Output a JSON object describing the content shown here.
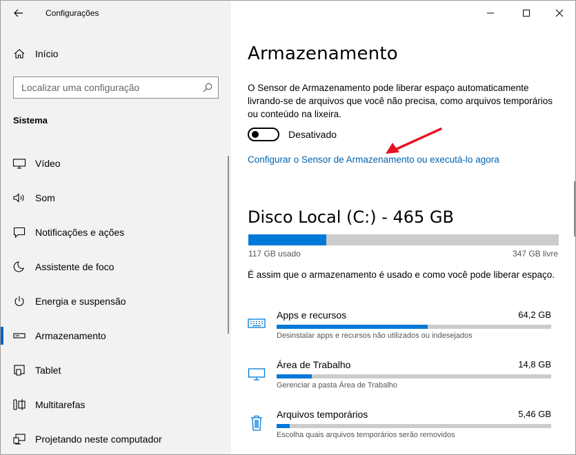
{
  "window": {
    "title": "Configurações",
    "minimize_icon": "minimize-icon",
    "maximize_icon": "maximize-icon",
    "close_icon": "close-icon"
  },
  "sidebar": {
    "home_label": "Início",
    "search_placeholder": "Localizar uma configuração",
    "section_title": "Sistema",
    "items": [
      {
        "label": "Vídeo",
        "icon": "monitor-icon"
      },
      {
        "label": "Som",
        "icon": "speaker-icon"
      },
      {
        "label": "Notificações e ações",
        "icon": "notification-icon"
      },
      {
        "label": "Assistente de foco",
        "icon": "moon-icon"
      },
      {
        "label": "Energia e suspensão",
        "icon": "power-icon"
      },
      {
        "label": "Armazenamento",
        "icon": "storage-icon",
        "active": true
      },
      {
        "label": "Tablet",
        "icon": "tablet-icon"
      },
      {
        "label": "Multitarefas",
        "icon": "multitask-icon"
      },
      {
        "label": "Projetando neste computador",
        "icon": "projecting-icon"
      }
    ]
  },
  "main": {
    "title": "Armazenamento",
    "description": "O Sensor de Armazenamento pode liberar espaço automaticamente livrando-se de arquivos que você não precisa, como arquivos temporários ou conteúdo na lixeira.",
    "toggle_state": "Desativado",
    "toggle_on": false,
    "configure_link": "Configurar o Sensor de Armazenamento ou executá-lo agora",
    "disk": {
      "title": "Disco Local (C:) - 465 GB",
      "used": "117 GB usado",
      "free": "347 GB livre",
      "used_fraction": 0.252
    },
    "usage_description": "É assim que o armazenamento é usado e como você pode liberar espaço.",
    "categories": [
      {
        "name": "Apps e recursos",
        "size": "64,2 GB",
        "subtitle": "Desinstalar apps e recursos não utilizados ou indesejados",
        "fraction": 0.55,
        "icon": "apps-keyboard-icon"
      },
      {
        "name": "Área de Trabalho",
        "size": "14,8 GB",
        "subtitle": "Gerenciar a pasta Área de Trabalho",
        "fraction": 0.127,
        "icon": "desktop-icon"
      },
      {
        "name": "Arquivos temporários",
        "size": "5,46 GB",
        "subtitle": "Escolha quais arquivos temporários serão removidos",
        "fraction": 0.047,
        "icon": "trash-icon"
      }
    ]
  },
  "colors": {
    "accent": "#0078d7",
    "link": "#0063b1",
    "annotation_arrow": "#e81123",
    "sidebar_bg": "#f2f2f2"
  }
}
